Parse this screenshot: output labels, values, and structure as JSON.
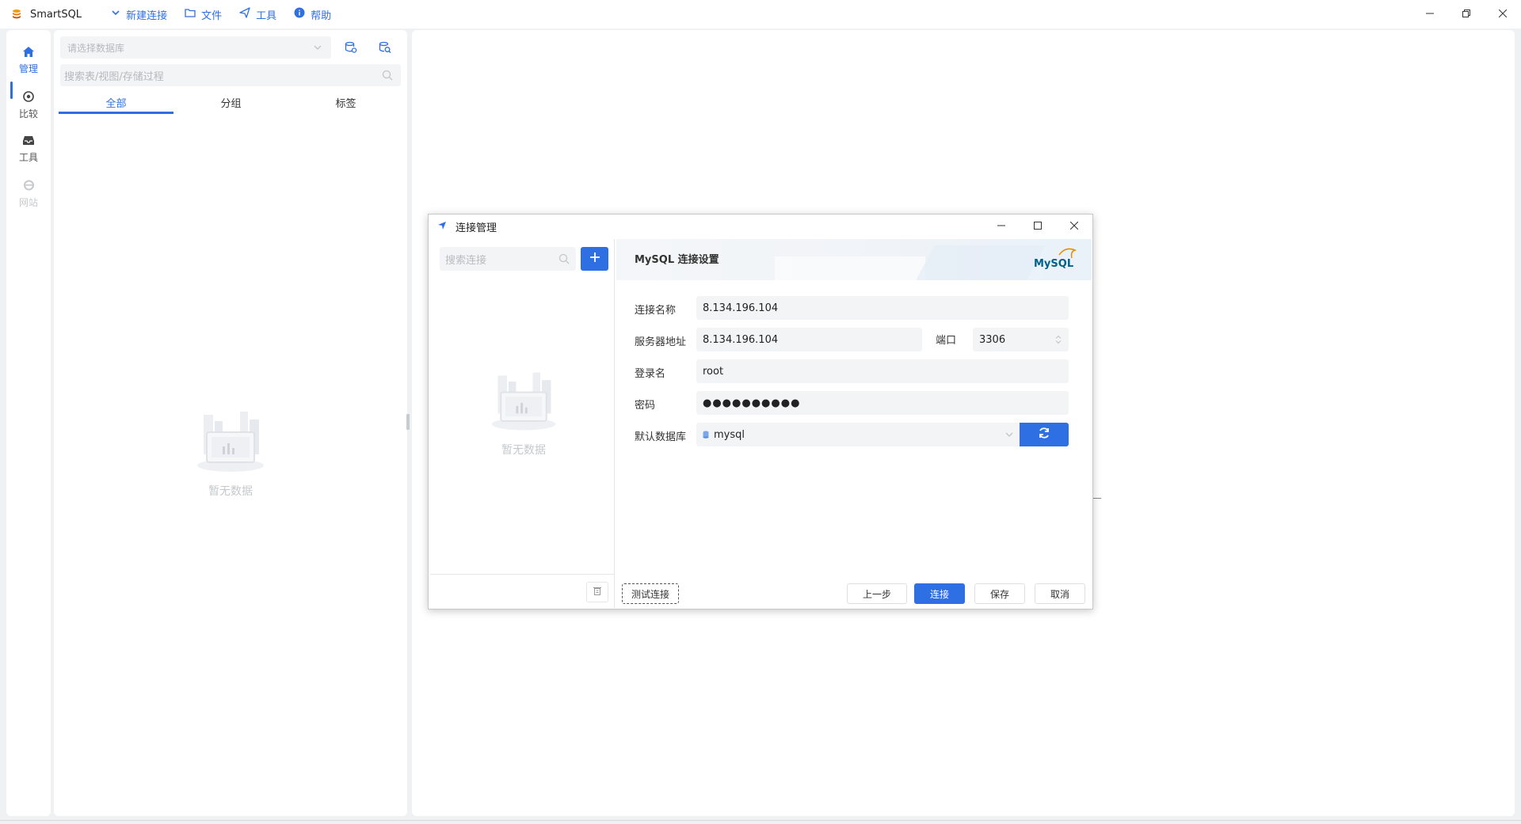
{
  "app": {
    "name": "SmartSQL",
    "menu": [
      {
        "label": "新建连接",
        "icon": "chevron-down-icon"
      },
      {
        "label": "文件",
        "icon": "folder-icon"
      },
      {
        "label": "工具",
        "icon": "send-icon"
      },
      {
        "label": "帮助",
        "icon": "info-icon"
      }
    ],
    "window_controls": [
      "minimize-icon",
      "restore-icon",
      "close-icon"
    ]
  },
  "activity_bar": {
    "items": [
      {
        "label": "管理",
        "icon": "home-icon",
        "state": "active"
      },
      {
        "label": "比较",
        "icon": "compass-icon",
        "state": "normal"
      },
      {
        "label": "工具",
        "icon": "inbox-icon",
        "state": "normal"
      },
      {
        "label": "网站",
        "icon": "ie-icon",
        "state": "disabled"
      }
    ]
  },
  "explorer": {
    "db_select_placeholder": "请选择数据库",
    "search_placeholder": "搜索表/视图/存储过程",
    "tabs": [
      {
        "label": "全部",
        "active": true
      },
      {
        "label": "分组",
        "active": false
      },
      {
        "label": "标签",
        "active": false
      }
    ],
    "empty_text": "暂无数据"
  },
  "dialog": {
    "title": "连接管理",
    "search_placeholder": "搜索连接",
    "empty_text": "暂无数据",
    "header_title": "MySQL 连接设置",
    "logo_text": "MySQL",
    "form": {
      "name_label": "连接名称",
      "name_value": "8.134.196.104",
      "server_label": "服务器地址",
      "server_value": "8.134.196.104",
      "port_label": "端口",
      "port_value": "3306",
      "user_label": "登录名",
      "user_value": "root",
      "password_label": "密码",
      "password_value": "●●●●●●●●●●",
      "db_label": "默认数据库",
      "db_value": "mysql"
    },
    "buttons": {
      "test": "测试连接",
      "prev": "上一步",
      "connect": "连接",
      "save": "保存",
      "cancel": "取消"
    }
  },
  "colors": {
    "accent": "#2f6fe4",
    "background": "#f0f1f3"
  }
}
